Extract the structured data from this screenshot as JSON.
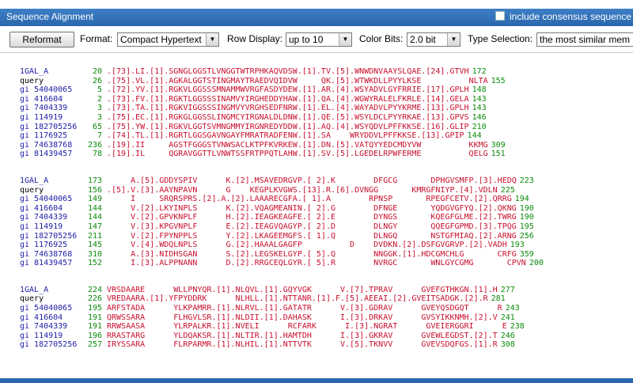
{
  "window": {
    "title": "Sequence Alignment",
    "consensus_label": "include consensus sequence"
  },
  "toolbar": {
    "reformat_label": "Reformat",
    "format_label": "Format:",
    "format_value": "Compact Hypertext",
    "row_display_label": "Row Display:",
    "row_display_value": "up to 10",
    "color_bits_label": "Color Bits:",
    "color_bits_value": "2.0 bit",
    "type_selection_label": "Type Selection:",
    "type_selection_value": "the most similar mem"
  },
  "blocks": [
    {
      "rows": [
        {
          "id": "1GAL_A",
          "start": "20",
          "seq": ".[73].LI.[1].SGNGLGGSTLVNGGTWTRPHKAQVDSW.[1].TV.[5].WNWDNVAAYSLQAE.[24].GTVH",
          "end": "172"
        },
        {
          "id": "query",
          "start": "26",
          "seq": ".[75].VL.[1].AGKALGGTSTINGMAYTRAEDVQIDVW     QK.[5].WTWKDLLPYYLKSE          NLTA",
          "end": "155"
        },
        {
          "id": "gi 54040065",
          "start": "5",
          "seq": ".[72].YV.[1].RGKVLGGSSSMNAMMWVRGFASDYDEW.[1].AR.[4].WSYADVLGYFRRIE.[17].GPLH",
          "end": "148"
        },
        {
          "id": "gi 416604",
          "start": "2",
          "seq": ".[73].FV.[1].RGKTLGGSSSINAMVYIRGHEDDYHAW.[1].QA.[4].WGWYRALELFKRLE.[14].GELA",
          "end": "143"
        },
        {
          "id": "gi 7404339",
          "start": "3",
          "seq": ".[73].TA.[1].RGKVIGGSSSINGMVYVRGHSEDFNRW.[1].EL.[4].WAYADVLPYYKRME.[13].GPLH",
          "end": "143"
        },
        {
          "id": "gi 114919",
          "start": "3",
          "seq": ".[75].EC.[1].RGKGLGGSSLINGMCYIRGNALDLDNW.[1].QE.[5].WSYLDCLPYYRKAE.[13].GPVS",
          "end": "146"
        },
        {
          "id": "gi 182705256",
          "start": "65",
          "seq": ".[75].YW.[1].RGKVLGGTSVMNGMMYIRGNREDYDDW.[1].AQ.[4].WSYQDVLPFFKKSE.[16].GLIP",
          "end": "210"
        },
        {
          "id": "gi 1176925",
          "start": "7",
          "seq": ".[74].TL.[1].RGRTLGGSGAVNGAYFMRATRADFENW.[1].SA    WRYDDVLPFFKKSE.[13].GPIP",
          "end": "144"
        },
        {
          "id": "gi 74638768",
          "start": "236",
          "seq": ".[19].II     AGSTFGGGSTVNWSACLKTPFKVRKEW.[1].DN.[5].VATQYYEDCMDYVW          KKMG",
          "end": "309"
        },
        {
          "id": "gi 81439457",
          "start": "78",
          "seq": ".[19].IL     QGRAVGGTTLVNWTSSFRTPPQTLAHW.[1].SV.[5].LGEDELRPWFERME          QELG",
          "end": "151"
        }
      ]
    },
    {
      "rows": [
        {
          "id": "1GAL_A",
          "start": "173",
          "seq": "     A.[5].GDDYSPIV      K.[2].MSAVEDRGVP.[ 2].K        DFGCG       DPHGVSMFP.[3].HEDQ",
          "end": "223"
        },
        {
          "id": "query",
          "start": "156",
          "seq": ".[5].V.[3].AAYNPAVN      G    KEGPLKVGWS.[13].R.[6].DVNGG       KMRGFNIYP.[4].VDLN",
          "end": "225"
        },
        {
          "id": "gi 54040065",
          "start": "149",
          "seq": "     I     SRQRSPRS.[2].A.[2].LAAARECGFA.[ 1].A        RPNSP       RPEGFCETV.[2].QRRG",
          "end": "194"
        },
        {
          "id": "gi 416604",
          "start": "144",
          "seq": "     V.[2].LKYINPLS      K.[2].VQAGMEANIN.[ 2].G        DFNGE       YQDGVGFYQ.[2].QKNG",
          "end": "190"
        },
        {
          "id": "gi 7404339",
          "start": "144",
          "seq": "     V.[2].GPVKNPLF      H.[2].IEAGKEAGFE.[ 2].E        DYNGS       KQEGFGLME.[2].TWRG",
          "end": "190"
        },
        {
          "id": "gi 114919",
          "start": "147",
          "seq": "     V.[3].KPGVNPLF      E.[2].IEAGVQAGYP.[ 2].D        DLNGY       QQEGFGPMD.[3].TPQG",
          "end": "195"
        },
        {
          "id": "gi 182705256",
          "start": "211",
          "seq": "     V.[2].FPYNPPLS      Y.[2].LKAGEEMGFS.[ 1].Q        DLNGQ       NSTGFMIAQ.[2].ARNG",
          "end": "256"
        },
        {
          "id": "gi 1176925",
          "start": "145",
          "seq": "     V.[4].WDQLNPLS      G.[2].HAAALGAGFP          D    DVDKN.[2].DSFGVGRVP.[2].VADH",
          "end": "193"
        },
        {
          "id": "gi 74638768",
          "start": "310",
          "seq": "     A.[3].NIDHSGAN      S.[2].LEGSKELGYP.[ 5].Q        NNGGK.[1].HDCGMCHLG       CRFG",
          "end": "359"
        },
        {
          "id": "gi 81439457",
          "start": "152",
          "seq": "     I.[3].ALPPNANN      D.[2].RRGCEQLGYR.[ 5].R        NVRGC       WNLGYCGMG       CPVN",
          "end": "200"
        }
      ]
    },
    {
      "rows": [
        {
          "id": "1GAL_A",
          "start": "224",
          "seq": "VRSDAARE      WLLPNYQR.[1].NLQVL.[1].GQYVGK      V.[7].TPRAV      GVEFGTHKGN.[1].H",
          "end": "277"
        },
        {
          "id": "query",
          "start": "226",
          "seq": "VREDAARA.[1].YFPYDDRK      NLHLL.[1].NTTANR.[1].F.[5].AEEAI.[2].GVEITSADGK.[2].R",
          "end": "281"
        },
        {
          "id": "gi 54040065",
          "start": "195",
          "seq": "ARFSTADA      YLKPAMRR.[1].NLRVL.[1].GATATR      V.[3].GDRAV      GVEYQSDGQT      R",
          "end": "243"
        },
        {
          "id": "gi 416604",
          "start": "191",
          "seq": "QRWSSARA      FLHGVLSR.[1].NLDII.[1].DAHASK      I.[3].DRKAV      GVSYIKKNMH.[2].V",
          "end": "241"
        },
        {
          "id": "gi 7404339",
          "start": "191",
          "seq": "RRWSAASA      YLRPALKR.[1].NVELI      RCFARK      I.[3].NGRAT      GVEIERGGRI      E",
          "end": "238"
        },
        {
          "id": "gi 114919",
          "start": "196",
          "seq": "RRASTARG      YLDQAKSR.[1].NLTIR.[1].HAMTDH      I.[3].GKRAV      GVEWLEGDST.[2].T",
          "end": "246"
        },
        {
          "id": "gi 182705256",
          "start": "257",
          "seq": "IRYSSARA      FLRPARMR.[1].NLHIL.[1].NTTVTK      V.[5].TKNVV      GVEVSDQFGS.[1].R",
          "end": "308"
        }
      ]
    }
  ]
}
